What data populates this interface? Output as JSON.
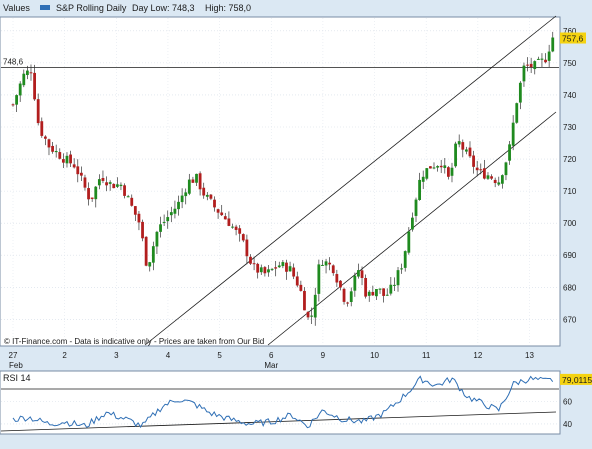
{
  "header": {
    "values_label": "Values",
    "legend_series": "S&P Rolling Daily",
    "day_low": "Day Low: 748,3",
    "day_high": "High: 758,0"
  },
  "main_panel": {
    "ref_level_label": "748,6",
    "last_price_label": "757,6",
    "y_ticks": [
      "760",
      "750",
      "740",
      "730",
      "720",
      "710",
      "700",
      "690",
      "680",
      "670"
    ],
    "disclaimer": "© IT-Finance.com - Data is indicative only - Prices are taken from Our Bid"
  },
  "x_axis": {
    "ticks": [
      "27",
      "2",
      "3",
      "4",
      "5",
      "6",
      "9",
      "10",
      "11",
      "12",
      "13"
    ],
    "months": [
      "Feb",
      "Mar"
    ]
  },
  "rsi_panel": {
    "title": "RSI 14",
    "value_label": "79,0115",
    "y_ticks": [
      "60",
      "40"
    ]
  },
  "colors": {
    "background": "#dbe8f3",
    "up_candle": "#1f8a1f",
    "down_candle": "#b21e1e",
    "rsi_line": "#2f6fb5",
    "last_price_tag": "#f5d311"
  },
  "chart_data": [
    {
      "type": "candlestick",
      "series": [
        {
          "name": "S&P Rolling Daily"
        }
      ],
      "x_categories": [
        "27",
        "2",
        "3",
        "4",
        "5",
        "6",
        "9",
        "10",
        "11",
        "12",
        "13"
      ],
      "ylim": [
        662,
        764
      ],
      "reference_line": 748.6,
      "last_price": 757.6,
      "close_path": [
        [
          0,
          737
        ],
        [
          0.2,
          746
        ],
        [
          0.35,
          748
        ],
        [
          0.5,
          730
        ],
        [
          0.7,
          724
        ],
        [
          1.0,
          720
        ],
        [
          1.2,
          718
        ],
        [
          1.5,
          707
        ],
        [
          1.7,
          715
        ],
        [
          1.9,
          712
        ],
        [
          2.1,
          712
        ],
        [
          2.3,
          705
        ],
        [
          2.45,
          700
        ],
        [
          2.6,
          686
        ],
        [
          2.8,
          698
        ],
        [
          3.0,
          702
        ],
        [
          3.2,
          706
        ],
        [
          3.4,
          713
        ],
        [
          3.55,
          714
        ],
        [
          3.7,
          709
        ],
        [
          3.9,
          705
        ],
        [
          4.2,
          700
        ],
        [
          4.45,
          694
        ],
        [
          4.65,
          686
        ],
        [
          4.9,
          684
        ],
        [
          5.15,
          687
        ],
        [
          5.35,
          686
        ],
        [
          5.55,
          680
        ],
        [
          5.75,
          668
        ],
        [
          5.95,
          689
        ],
        [
          6.2,
          686
        ],
        [
          6.45,
          675
        ],
        [
          6.7,
          686
        ],
        [
          6.85,
          677
        ],
        [
          7.05,
          680
        ],
        [
          7.2,
          677
        ],
        [
          7.35,
          680
        ],
        [
          7.55,
          688
        ],
        [
          7.7,
          701
        ],
        [
          7.9,
          715
        ],
        [
          8.1,
          718
        ],
        [
          8.3,
          719
        ],
        [
          8.45,
          713
        ],
        [
          8.6,
          726
        ],
        [
          8.8,
          721
        ],
        [
          9.0,
          716
        ],
        [
          9.2,
          715
        ],
        [
          9.4,
          713
        ],
        [
          9.6,
          722
        ],
        [
          9.75,
          738
        ],
        [
          9.9,
          749
        ],
        [
          10.1,
          749
        ],
        [
          10.3,
          751
        ],
        [
          10.45,
          758
        ]
      ]
    },
    {
      "type": "line",
      "name": "RSI 14",
      "ylim": [
        32,
        86
      ],
      "last_value": 79.0115,
      "path": [
        [
          0,
          44
        ],
        [
          0.3,
          46
        ],
        [
          0.7,
          40
        ],
        [
          1.0,
          42
        ],
        [
          1.4,
          38
        ],
        [
          1.8,
          50
        ],
        [
          2.2,
          44
        ],
        [
          2.5,
          38
        ],
        [
          2.9,
          56
        ],
        [
          3.2,
          62
        ],
        [
          3.5,
          58
        ],
        [
          3.8,
          50
        ],
        [
          4.2,
          44
        ],
        [
          4.6,
          40
        ],
        [
          5.0,
          42
        ],
        [
          5.4,
          48
        ],
        [
          5.7,
          38
        ],
        [
          6.0,
          52
        ],
        [
          6.4,
          44
        ],
        [
          6.8,
          42
        ],
        [
          7.2,
          50
        ],
        [
          7.6,
          66
        ],
        [
          7.9,
          80
        ],
        [
          8.2,
          74
        ],
        [
          8.5,
          80
        ],
        [
          8.8,
          64
        ],
        [
          9.1,
          58
        ],
        [
          9.4,
          52
        ],
        [
          9.7,
          76
        ],
        [
          10.0,
          80
        ],
        [
          10.3,
          78
        ],
        [
          10.45,
          79
        ]
      ]
    }
  ]
}
